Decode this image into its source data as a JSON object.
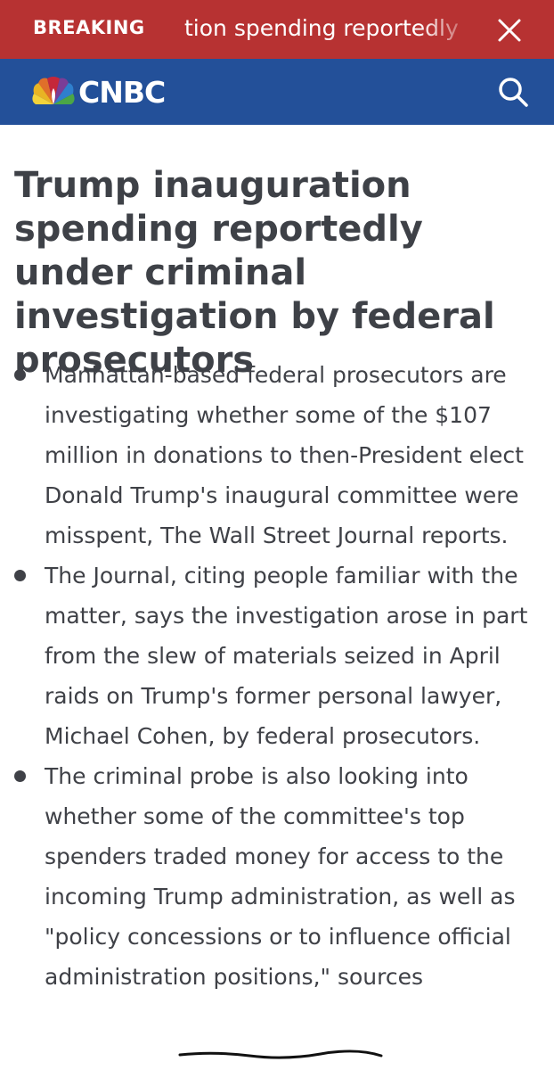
{
  "breaking": {
    "label": "BREAKING",
    "ticker": "tion spending reportedly"
  },
  "header": {
    "logo_text": "CNBC"
  },
  "article": {
    "headline": "Trump inauguration spending reportedly under criminal investigation by federal prosecutors",
    "bullets": [
      "Manhattan-based federal prosecutors are investigating whether some of the $107 million in donations to then-President elect Donald Trump's inaugural committee were misspent, The Wall Street Journal reports.",
      "The Journal, citing people familiar with the matter, says the investigation arose in part from the slew of materials seized in April raids on Trump's former personal lawyer, Michael Cohen, by federal prosecutors.",
      "The criminal probe is also looking into whether some of the committee's top spenders traded money for access to the incoming Trump administration, as well as \"policy concessions or to influence official administration positions,\" sources"
    ]
  },
  "colors": {
    "breaking_bg": "#b73232",
    "nav_bg": "#235099",
    "text": "#3f4147"
  },
  "icons": [
    "close-icon",
    "nbc-peacock-icon",
    "search-icon"
  ]
}
